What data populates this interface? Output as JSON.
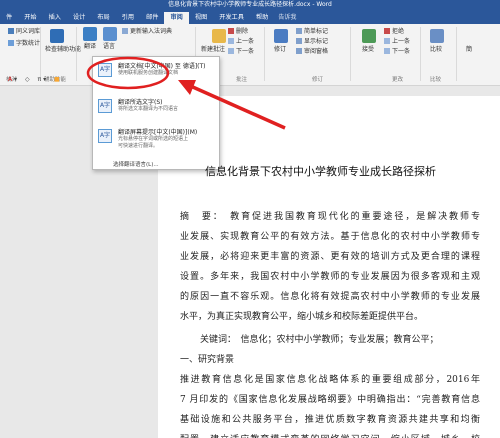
{
  "window": {
    "title": "信息化背景下农村中小学教师专业成长路径探析.docx - Word"
  },
  "tabs": [
    {
      "label": "件"
    },
    {
      "label": "开始"
    },
    {
      "label": "插入"
    },
    {
      "label": "设计"
    },
    {
      "label": "布局"
    },
    {
      "label": "引用"
    },
    {
      "label": "邮件"
    },
    {
      "label": "审阅",
      "active": true
    },
    {
      "label": "视图"
    },
    {
      "label": "开发工具"
    },
    {
      "label": "帮助"
    },
    {
      "label": "告诉我"
    }
  ],
  "ribbon": {
    "thesaurus": "同义词库",
    "word_count": "字数统计",
    "check_accessibility": "检查辅助功能",
    "accessibility_group": "辅助功能",
    "translate": "翻译",
    "language": "语言",
    "update_ime": "更新输入法词典",
    "new_comment": "新建批注",
    "delete": "删除",
    "previous": "上一条",
    "next": "下一条",
    "track_changes": "修订",
    "simple_markup": "简单标记",
    "show_markup": "显示标记",
    "review_pane": "审阅窗格",
    "accept": "接受",
    "reject": "拒绝",
    "compare": "比较",
    "comments_group": "批注",
    "tracking_group": "修订",
    "changes_group": "更改",
    "compare_group": "比较",
    "proofing_group": "校对",
    "side_trunc": "簡"
  },
  "translate_menu": {
    "item1_title": "翻译文档[中文(中国) 至 德语](T)",
    "item1_desc": "使用联机服务创建翻译文档",
    "item2_title": "翻译所选文字(S)",
    "item2_desc": "将所选文本翻译为不同语言",
    "item3_title": "翻译屏幕提示[中文(中国)](M)",
    "item3_desc1": "光标悬停在字词或所选的短语上",
    "item3_desc2": "可快速进行翻译。",
    "choose_language": "选择翻译语言(L)..."
  },
  "document": {
    "title": "信息化背景下农村中小学教师专业成长路径探析",
    "abstract_lines": [
      "摘　要：　教育促进我国教育现代化的重要途径，是解决教师专",
      "业发展、实现教育公平的有效方法。基于信息化的农村中小学教师专",
      "业发展，必将迎来更丰富的资源、更有效的培训方式及更合理的课程",
      "设置。多年来，我国农村中小学教师的专业发展因为很多客观和主观",
      "的原因一直不容乐观。信息化将有效提高农村中小学教师的专业发展",
      "水平，为真正实现教育公平，缩小城乡和校际差距提供平台。"
    ],
    "keywords": "关键词：　信息化；农村中小学教师；专业发展；教育公平；",
    "section1": "一、研究背景",
    "body_lines": [
      "推进教育信息化是国家信息化战略体系的重要组成部分，2016年",
      "7 月印发的《国家信息化发展战略纲要》中明确指出：“完善教育信息",
      "基础设施和公共服务平台，推进优质数字教育资源共建共享和均衡",
      "配置，建立适应教育模式变革的网络学习空间，缩小区域、城乡、校"
    ]
  }
}
